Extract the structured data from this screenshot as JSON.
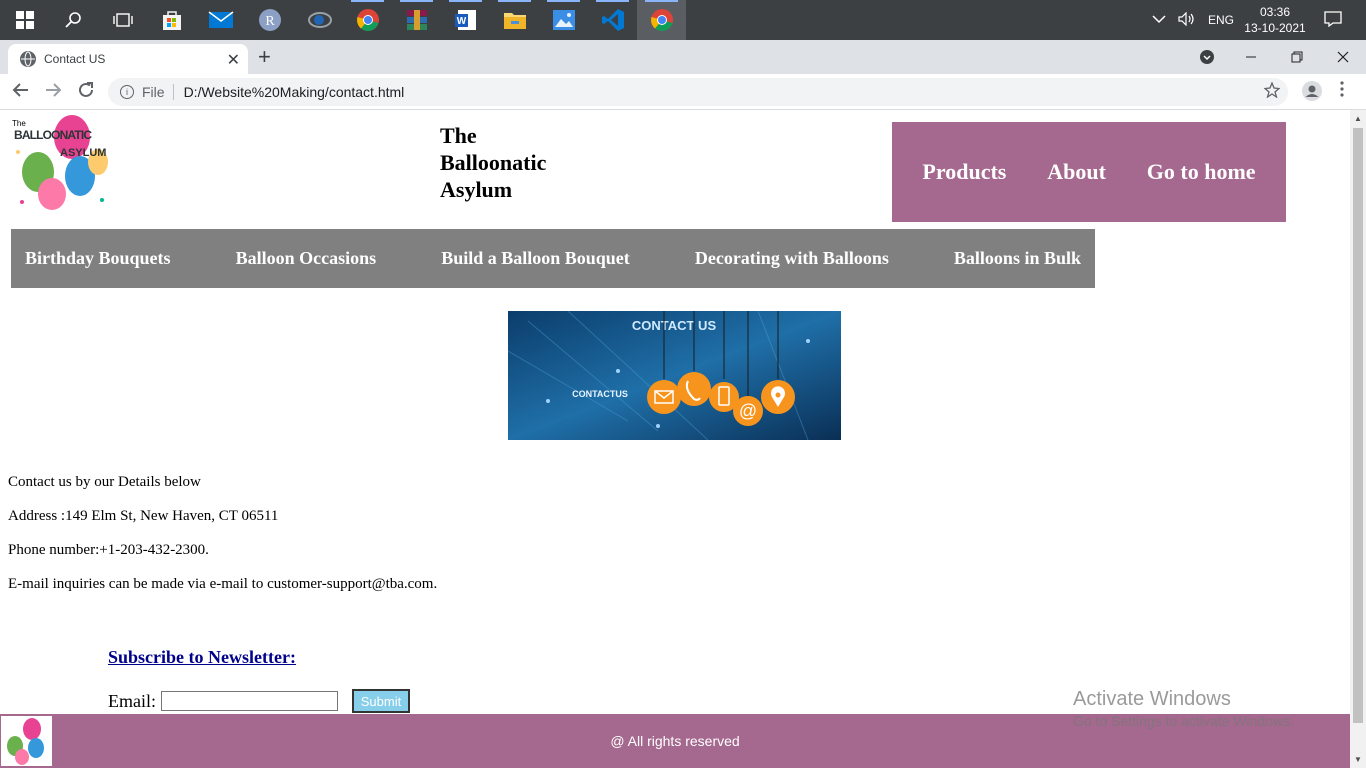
{
  "taskbar": {
    "apps": [
      "windows-start",
      "search",
      "task-view",
      "store",
      "mail",
      "r-app",
      "rstudio",
      "chrome",
      "winrar",
      "word",
      "file-explorer",
      "photos",
      "vscode",
      "chrome-active"
    ],
    "lang": "ENG",
    "time": "03:36",
    "date": "13-10-2021"
  },
  "browser": {
    "tab_title": "Contact US",
    "new_tab": "+",
    "close_tab": "✕",
    "scheme_label": "File",
    "url": "D:/Website%20Making/contact.html"
  },
  "site": {
    "title_line1": "The",
    "title_line2": "Balloonatic",
    "title_line3": "Asylum",
    "logo_text_1": "The",
    "logo_text_2": "BALLOONATIC",
    "logo_text_3": "ASYLUM",
    "top_nav": [
      "Products",
      "About",
      "Go to home"
    ],
    "categories": [
      "Birthday Bouquets",
      "Balloon Occasions",
      "Build a Balloon Bouquet",
      "Decorating with Balloons",
      "Balloons in Bulk"
    ],
    "banner_title": "CONTACT US",
    "banner_sub": "CONTACTUS"
  },
  "contact": {
    "intro": "Contact us by our Details below",
    "address": "Address :149 Elm St, New Haven, CT 06511",
    "phone": "Phone number:+1-203-432-2300.",
    "email": "E-mail inquiries can be made via e-mail to customer-support@tba.com."
  },
  "newsletter": {
    "title": "Subscribe to Newsletter:",
    "email_label": "Email:",
    "email_value": "",
    "submit_label": "Submit"
  },
  "watermark": {
    "line1": "Activate Windows",
    "line2": "Go to Settings to activate Windows."
  },
  "footer": {
    "text": "@ All rights reserved"
  },
  "colors": {
    "nav_purple": "#a5688e",
    "category_gray": "#808080",
    "link_navy": "#00008b",
    "submit_blue": "#87ceeb"
  }
}
